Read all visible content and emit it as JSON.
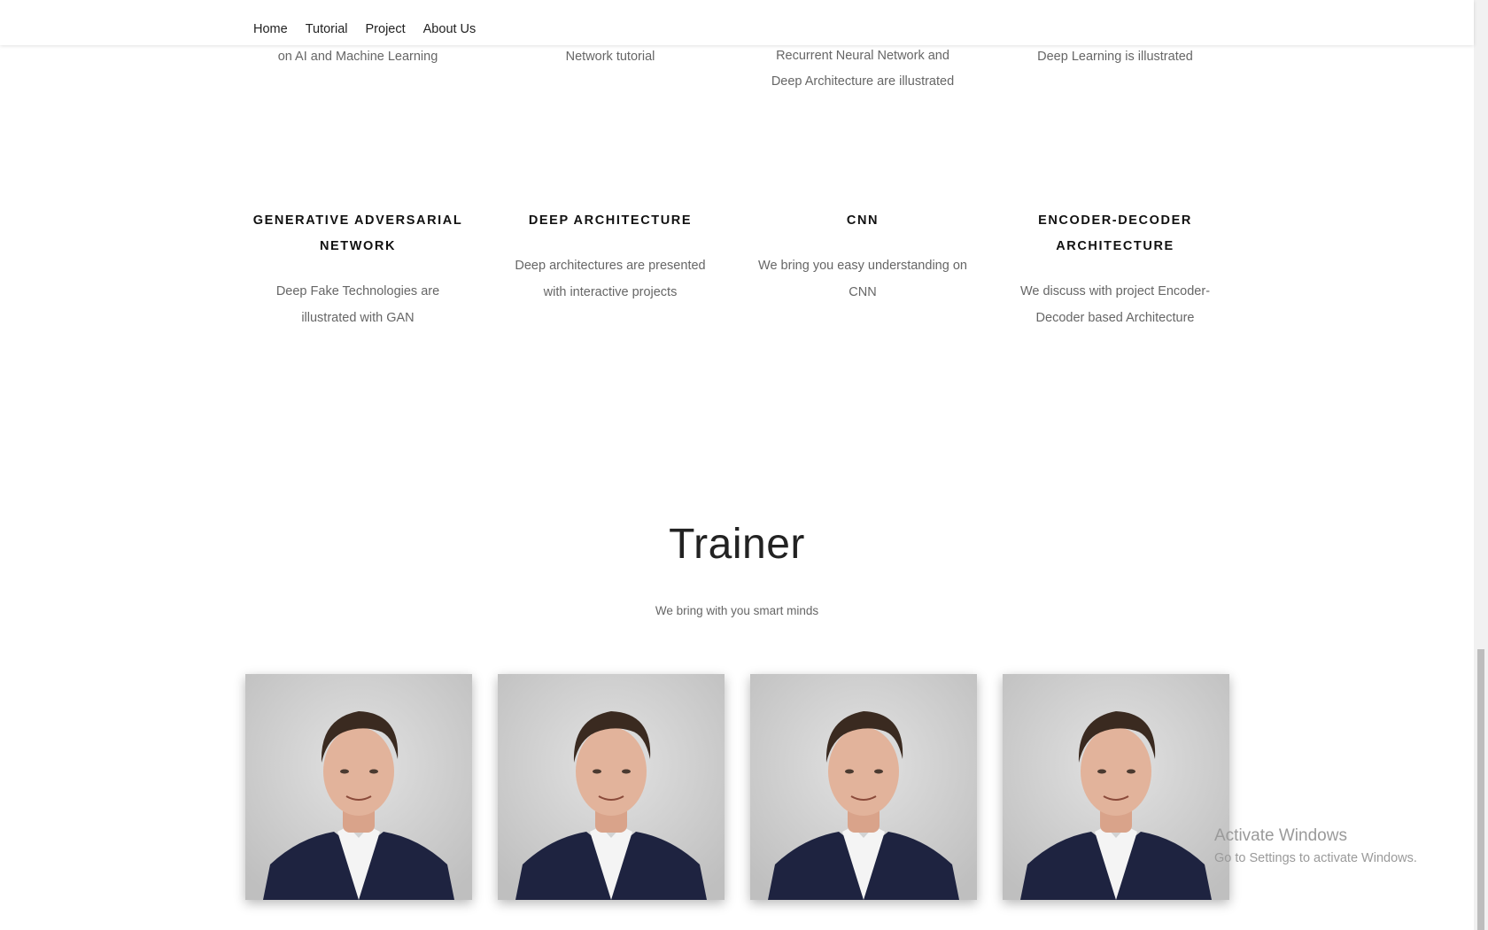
{
  "nav": {
    "items": [
      {
        "label": "Home"
      },
      {
        "label": "Tutorial"
      },
      {
        "label": "Project"
      },
      {
        "label": "About Us"
      }
    ]
  },
  "top_row": [
    {
      "desc": "on AI and Machine Learning"
    },
    {
      "desc": "Network tutorial"
    },
    {
      "desc_line1": "Recurrent Neural Network and",
      "desc_line2": "Deep Architecture are illustrated"
    },
    {
      "desc": "Deep Learning is illustrated"
    }
  ],
  "features": [
    {
      "title": "GENERATIVE ADVERSARIAL NETWORK",
      "desc": "Deep Fake Technologies are illustrated with GAN"
    },
    {
      "title": "DEEP ARCHITECTURE",
      "desc": "Deep architectures are presented with interactive projects"
    },
    {
      "title": "CNN",
      "desc": "We bring you easy understanding on CNN"
    },
    {
      "title": "ENCODER-DECODER ARCHITECTURE",
      "desc": "We discuss with project Encoder-Decoder based Architecture"
    }
  ],
  "trainer": {
    "title": "Trainer",
    "subtitle": "We bring with you smart minds"
  },
  "watermark": {
    "line1": "Activate Windows",
    "line2": "Go to Settings to activate Windows."
  }
}
